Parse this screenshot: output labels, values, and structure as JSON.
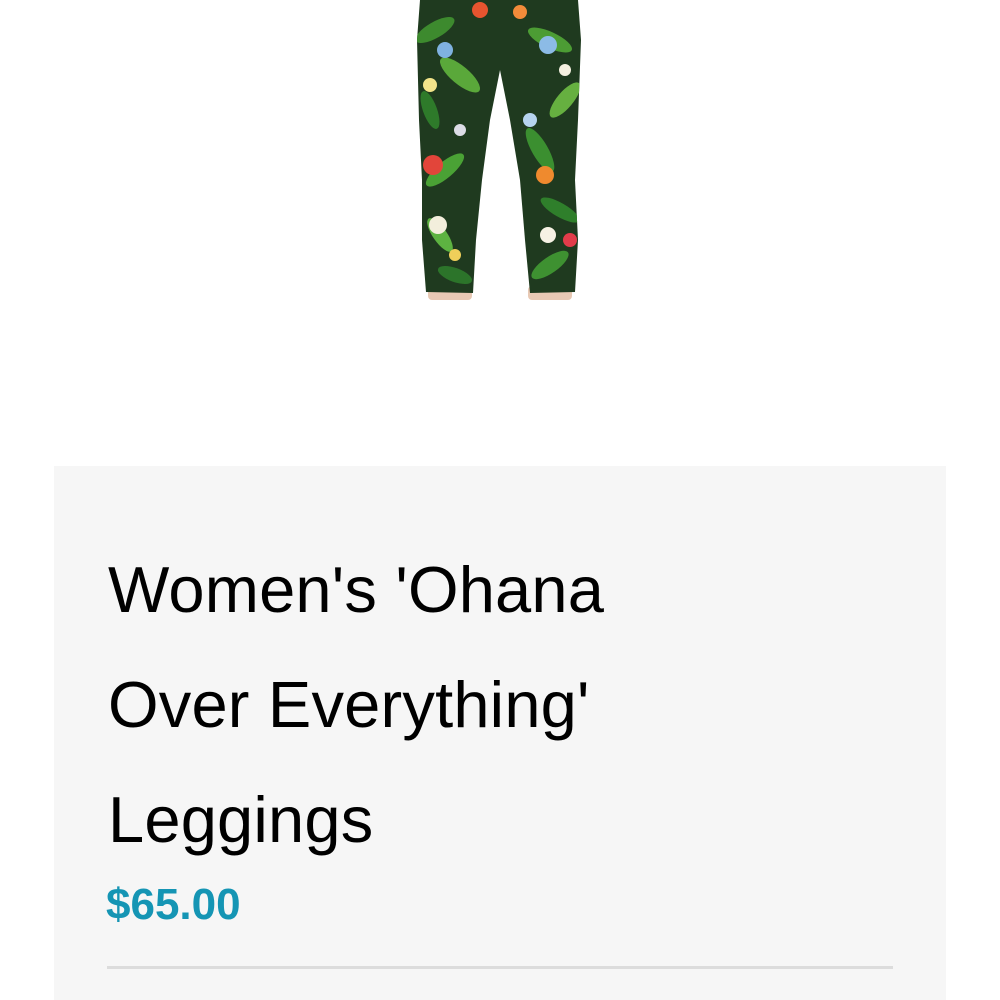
{
  "product": {
    "title_lines": [
      "Women's 'Ohana",
      "Over Everything'",
      "Leggings"
    ],
    "price": "$65.00"
  },
  "colors": {
    "accent": "#1595b4",
    "card_background": "#f6f6f6",
    "divider": "#dcdcdc"
  },
  "icons": {
    "product_image": "tropical-floral-leggings-image"
  }
}
